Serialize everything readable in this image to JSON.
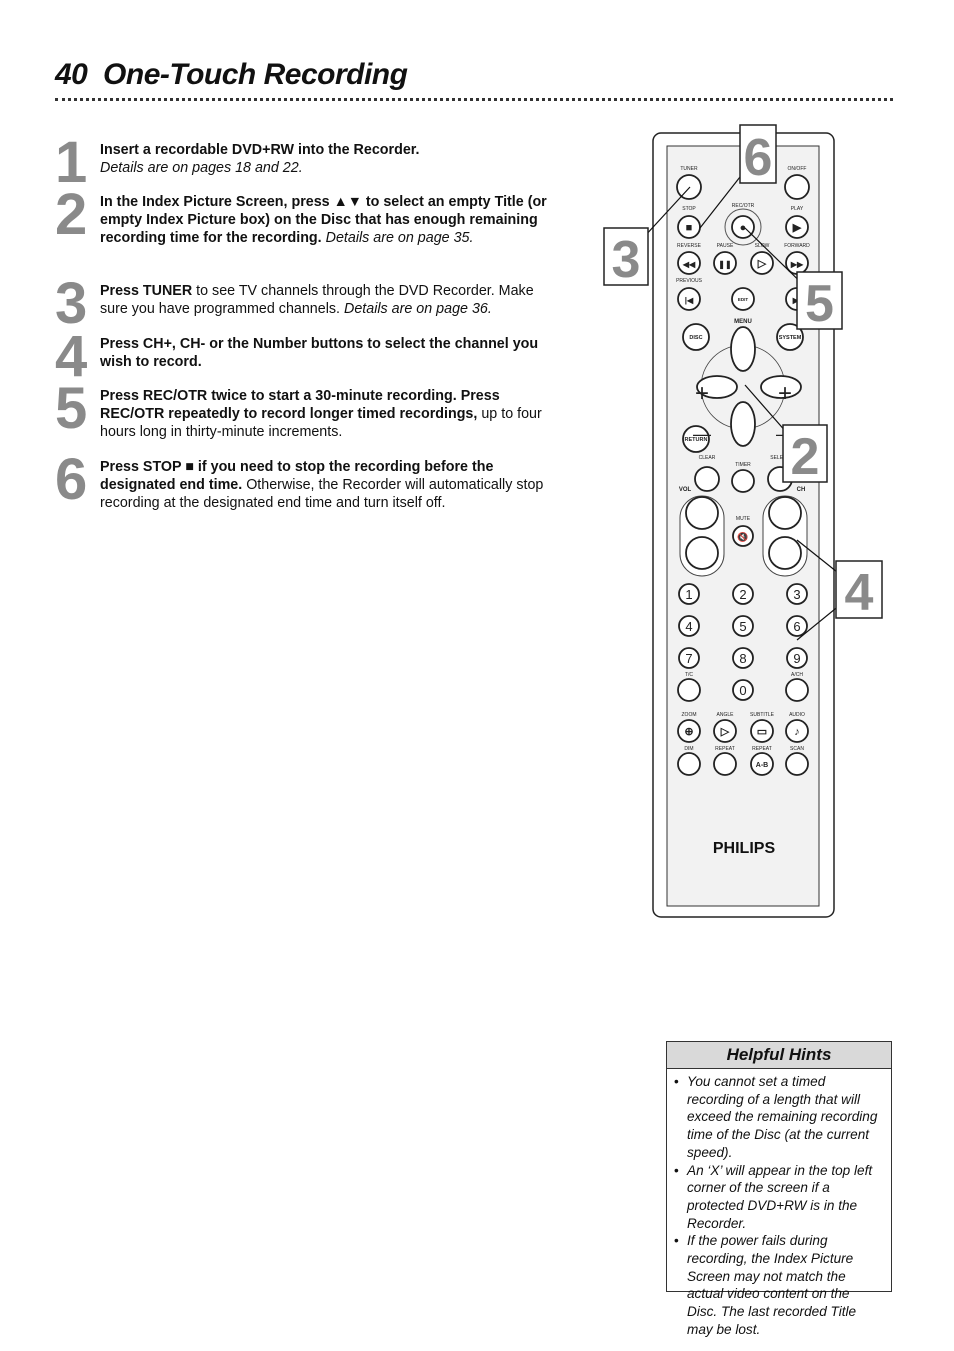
{
  "header": {
    "page_number": "40",
    "title": "One-Touch Recording"
  },
  "steps": [
    {
      "number": "1",
      "bold": "Insert a recordable DVD+RW into the Recorder.",
      "normal": "",
      "italic": "Details are on pages 18 and 22."
    },
    {
      "number": "2",
      "bold": "In the Index Picture Screen, press ▲▼ to select an empty Title (or empty Index Picture box) on the Disc that has enough remaining recording time for the recording.",
      "normal": "",
      "italic": "Details are on page 35."
    },
    {
      "number": "3",
      "bold": "Press TUNER",
      "normal": "to see TV channels through the DVD Recorder. Make sure you have programmed channels.",
      "italic": "Details are on page 36."
    },
    {
      "number": "4",
      "bold": "Press CH+, CH- or the Number buttons to select the channel you wish to record.",
      "normal": "",
      "italic": ""
    },
    {
      "number": "5",
      "bold": "Press REC/OTR twice to start a 30-minute recording. Press REC/OTR repeatedly to record longer timed recordings,",
      "normal": "up to four hours long in thirty-minute increments.",
      "italic": ""
    },
    {
      "number": "6",
      "bold": "Press STOP ■ if you need to stop the recording before the designated end time.",
      "normal": "Otherwise, the Recorder will automatically stop recording at the designated end time and turn itself off.",
      "italic": ""
    }
  ],
  "remote": {
    "brand": "PHILIPS",
    "labels": {
      "tuner": "TUNER",
      "onoff": "ON/OFF",
      "stop": "STOP",
      "recotr": "REC/OTR",
      "play": "PLAY",
      "reverse": "REVERSE",
      "pause": "PAUSE",
      "slow": "SLOW",
      "forward": "FORWARD",
      "previous": "PREVIOUS",
      "edit": "EDIT",
      "menu": "MENU",
      "disc": "DISC",
      "system": "SYSTEM",
      "return": "RETURN",
      "clear": "CLEAR",
      "timer": "TIMER",
      "select": "SELECT",
      "vol": "VOL",
      "ch": "CH",
      "mute": "MUTE",
      "tc": "T/C",
      "ach": "A/CH",
      "zoom": "ZOOM",
      "angle": "ANGLE",
      "subtitle": "SUBTITLE",
      "audio": "AUDIO",
      "dim": "DIM",
      "repeat": "REPEAT",
      "repeat_ab": "REPEAT",
      "ab": "A-B"
    },
    "digits": [
      "1",
      "2",
      "3",
      "4",
      "5",
      "6",
      "7",
      "8",
      "9",
      "0"
    ],
    "callouts": [
      "6",
      "3",
      "5",
      "2",
      "4"
    ],
    "callout_color": "#8a8a8a"
  },
  "hints": {
    "title": "Helpful Hints",
    "items": [
      "You cannot set a timed recording of a length that will exceed the remaining recording time of the Disc (at the current speed).",
      "An ‘X’ will appear in the top left corner of the screen if a protected DVD+RW is in the Recorder.",
      "If the power fails during recording, the Index Picture Screen may not match the actual video content on the Disc. The last recorded Title may be lost."
    ]
  }
}
